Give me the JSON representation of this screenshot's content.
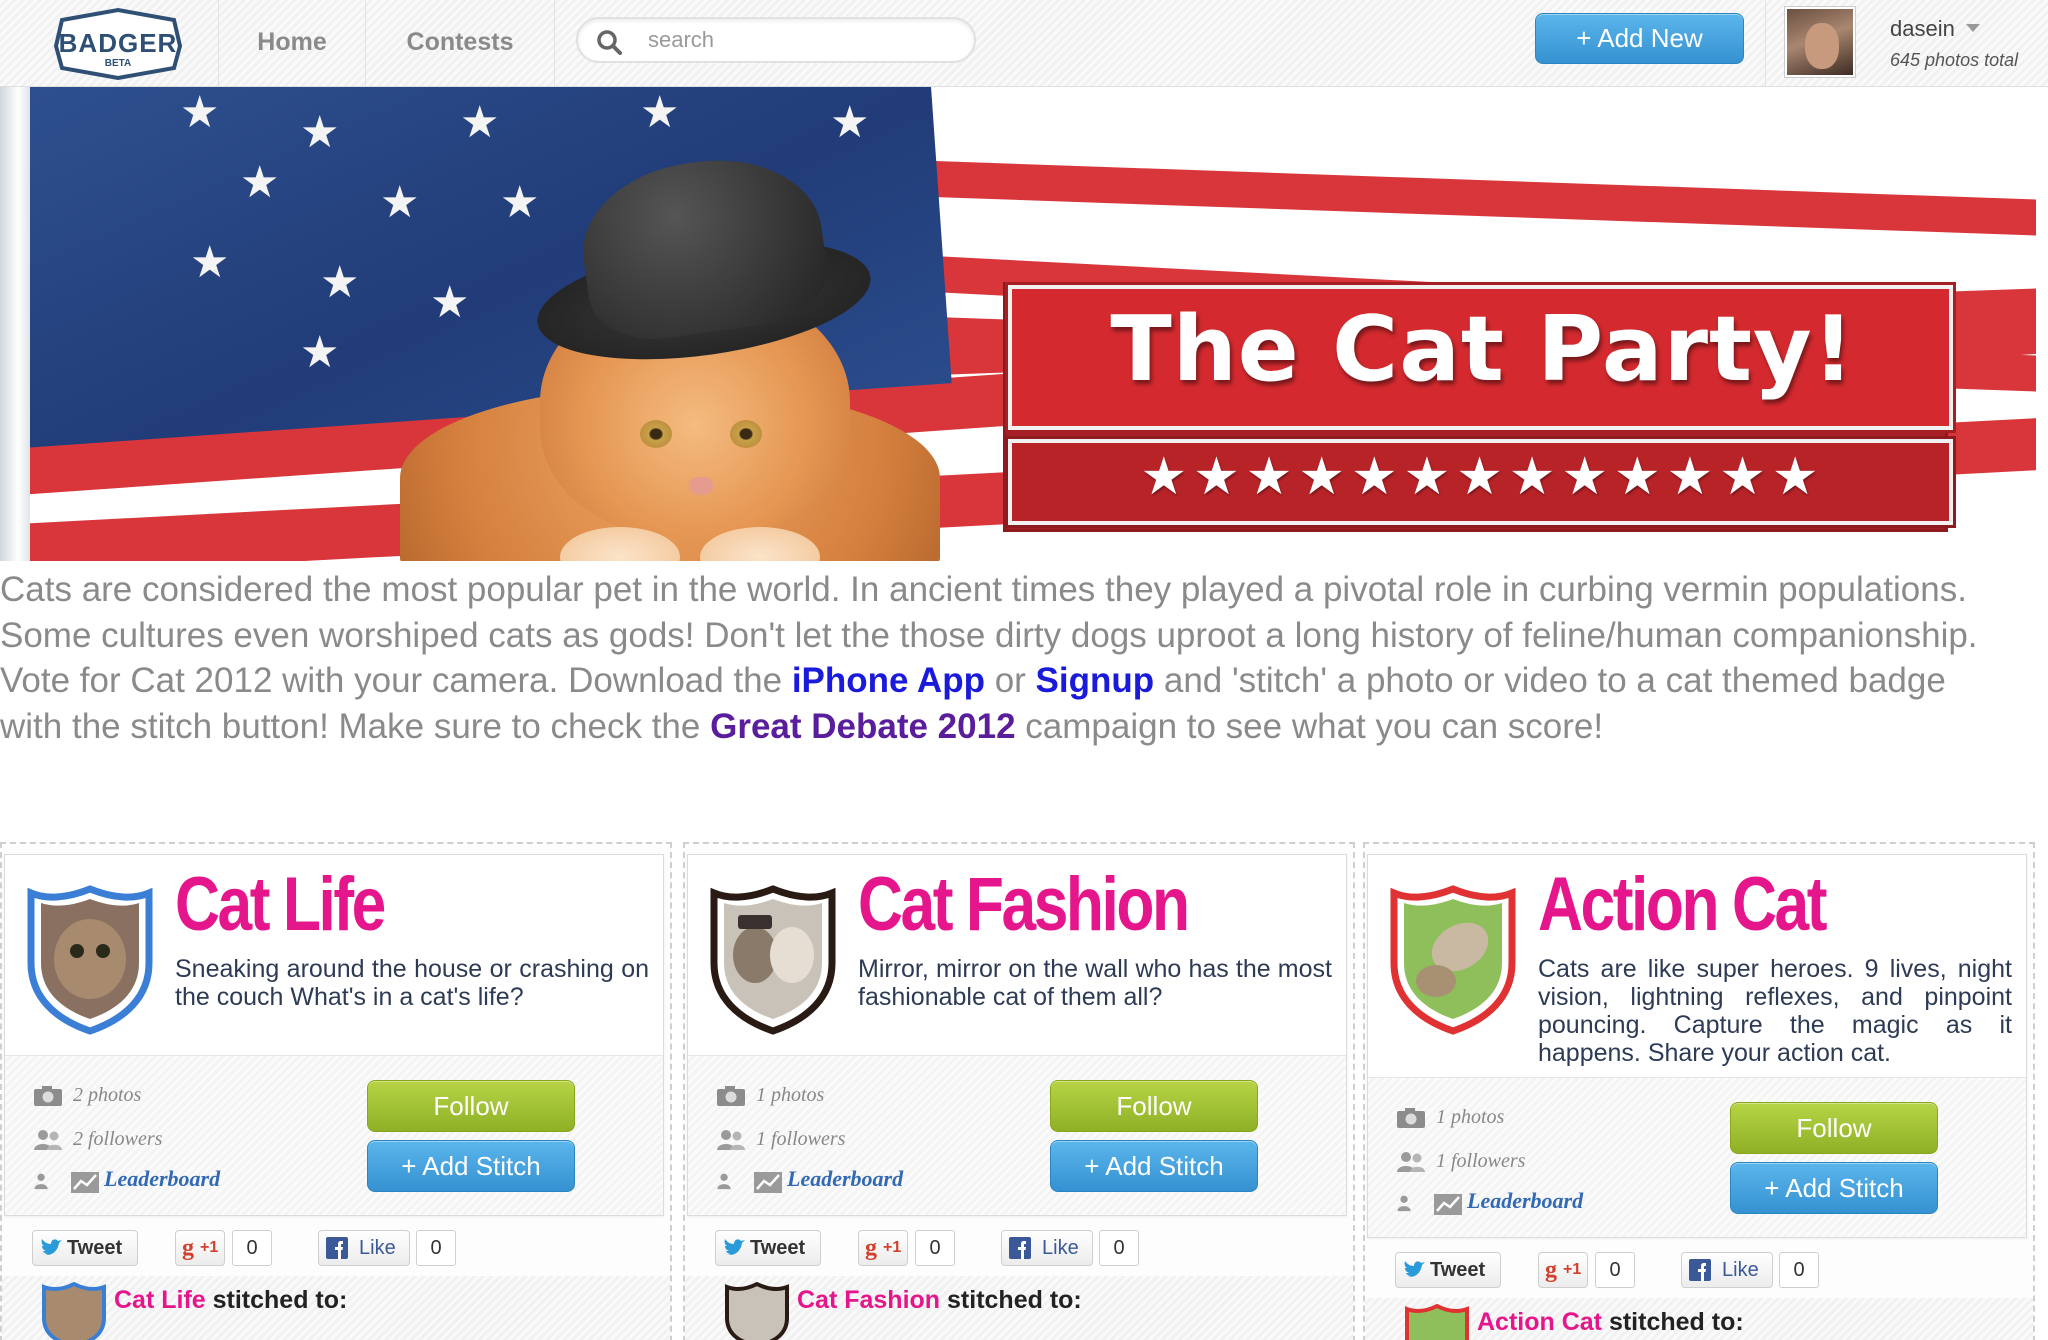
{
  "header": {
    "logo_text": "BADGER",
    "logo_subtext": "BETA",
    "nav": [
      "Home",
      "Contests"
    ],
    "search_placeholder": "search",
    "add_new_label": "+ Add New",
    "username": "dasein",
    "photos_total": "645 photos total"
  },
  "banner": {
    "title": "The Cat Party!",
    "stars": "★★★★★★★★★★★★★"
  },
  "description": {
    "part1": "Cats are considered the most popular pet in the world. In ancient times they played a pivotal role in curbing vermin populations. Some cultures even worshiped cats as gods! Don't let the those dirty dogs uproot a long history of feline/human companionship. Vote for Cat 2012 with your camera. Download the ",
    "link_iphone": "iPhone App",
    "part2": " or ",
    "link_signup": "Signup",
    "part3": " and 'stitch' a photo or video to a cat themed badge with the stitch button! Make sure to check the ",
    "link_debate": "Great Debate 2012",
    "part4": " campaign to see what you can score!"
  },
  "cards": [
    {
      "title": "Cat Life",
      "description": "Sneaking around the house or crashing on the couch What's in a cat's life?",
      "photos": "2 photos",
      "followers": "2 followers",
      "leaderboard": "Leaderboard",
      "follow_label": "Follow",
      "stitch_label": "+ Add Stitch",
      "tweet_label": "Tweet",
      "gplus_label": "+1",
      "gplus_count": "0",
      "like_label": "Like",
      "like_count": "0",
      "stitched_name": "Cat Life",
      "stitched_suffix": " stitched to:",
      "badge_color": "#3a7fd5"
    },
    {
      "title": "Cat Fashion",
      "description": "Mirror, mirror on the wall who has the most fashionable cat of them all?",
      "photos": "1 photos",
      "followers": "1 followers",
      "leaderboard": "Leaderboard",
      "follow_label": "Follow",
      "stitch_label": "+ Add Stitch",
      "tweet_label": "Tweet",
      "gplus_label": "+1",
      "gplus_count": "0",
      "like_label": "Like",
      "like_count": "0",
      "stitched_name": "Cat Fashion",
      "stitched_suffix": " stitched to:",
      "badge_color": "#2a1a14"
    },
    {
      "title": "Action Cat",
      "description": "Cats are like super heroes. 9 lives, night vision, lightning reflexes, and pinpoint pouncing. Capture the magic as it happens. Share your action cat.",
      "photos": "1 photos",
      "followers": "1 followers",
      "leaderboard": "Leaderboard",
      "follow_label": "Follow",
      "stitch_label": "+ Add Stitch",
      "tweet_label": "Tweet",
      "gplus_label": "+1",
      "gplus_count": "0",
      "like_label": "Like",
      "like_count": "0",
      "stitched_name": "Action Cat",
      "stitched_suffix": " stitched to:",
      "badge_color": "#e03232"
    }
  ],
  "colors": {
    "accent_pink": "#e5168b",
    "follow_green": "#9bbb2e",
    "stitch_blue": "#3591d1",
    "link_blue": "#1a1adb",
    "link_purple": "#5a1d9b"
  }
}
